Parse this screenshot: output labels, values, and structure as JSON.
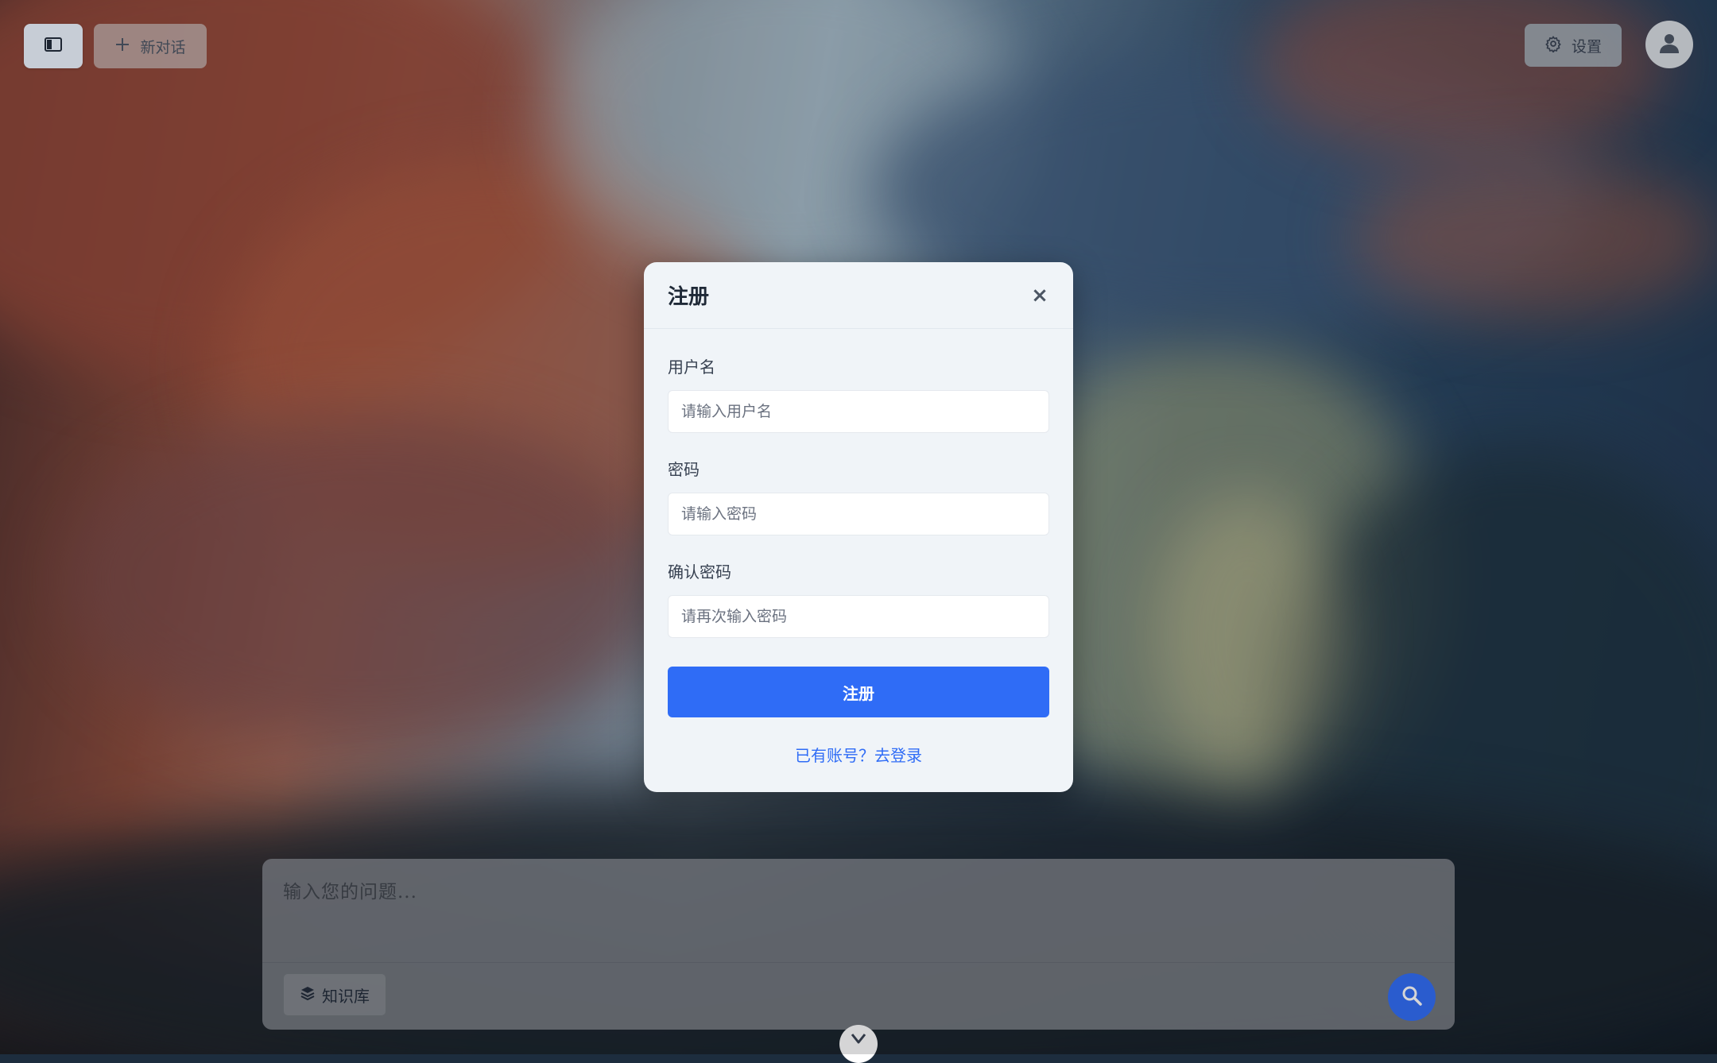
{
  "toolbar": {
    "new_chat_label": "新对话",
    "settings_label": "设置"
  },
  "modal": {
    "title": "注册",
    "close_icon": "×",
    "username": {
      "label": "用户名",
      "placeholder": "请输入用户名",
      "value": ""
    },
    "password": {
      "label": "密码",
      "placeholder": "请输入密码",
      "value": ""
    },
    "confirm_password": {
      "label": "确认密码",
      "placeholder": "请再次输入密码",
      "value": ""
    },
    "submit_label": "注册",
    "login_link": "已有账号？去登录"
  },
  "chat": {
    "placeholder": "输入您的问题...",
    "knowledge_base_label": "知识库"
  },
  "icons": {
    "sidebar_toggle": "sidebar-toggle-icon",
    "new_chat": "plus-icon",
    "settings": "gear-icon",
    "avatar": "user-icon",
    "close": "close-icon",
    "knowledge_base": "layers-icon",
    "search": "search-icon",
    "scroll": "chevron-down-icon"
  },
  "colors": {
    "accent": "#2f6cf6",
    "modal_bg": "#f0f4f8",
    "title": "#1f2937"
  }
}
